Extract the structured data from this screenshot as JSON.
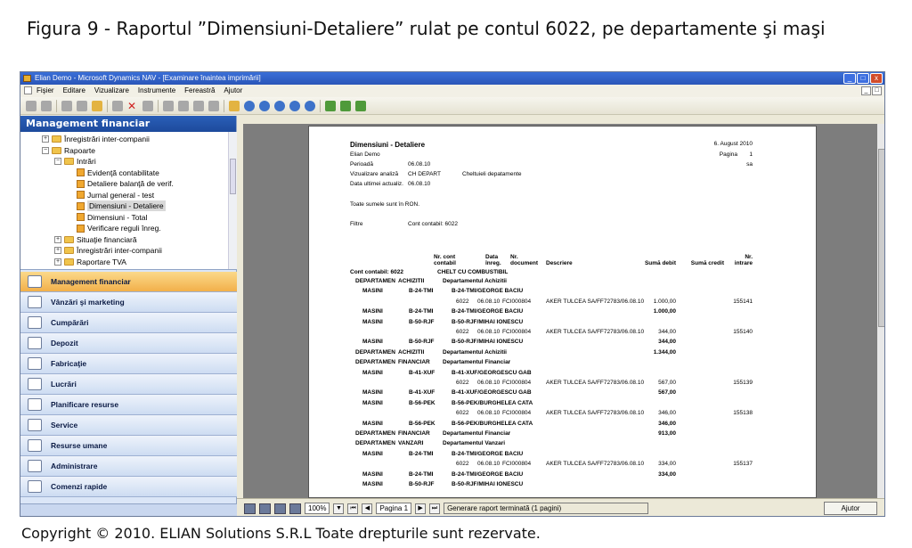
{
  "caption": "Figura 9 - Raportul ”Dimensiuni-Detaliere” rulat pe contul 6022, pe departamente şi maşi",
  "copyright": "Copyright © 2010. ELIAN Solutions S.R.L Toate drepturile sunt rezervate.",
  "window": {
    "title": "Elian Demo - Microsoft Dynamics NAV - [Examinare înaintea imprimării]",
    "buttons": [
      "_",
      "□",
      "x"
    ]
  },
  "menu": [
    "Fişier",
    "Editare",
    "Vizualizare",
    "Instrumente",
    "Fereastră",
    "Ajutor"
  ],
  "nav": {
    "header": "Management financiar",
    "tree": [
      {
        "label": "Înregistrări inter-companii",
        "level": 1,
        "kind": "folder",
        "exp": "+"
      },
      {
        "label": "Rapoarte",
        "level": 1,
        "kind": "folder",
        "exp": "-"
      },
      {
        "label": "Intrări",
        "level": 2,
        "kind": "folder",
        "exp": "-"
      },
      {
        "label": "Evidenţă contabilitate",
        "level": 3,
        "kind": "report"
      },
      {
        "label": "Detaliere balanţă de verif.",
        "level": 3,
        "kind": "report"
      },
      {
        "label": "Jurnal general - test",
        "level": 3,
        "kind": "report"
      },
      {
        "label": "Dimensiuni - Detaliere",
        "level": 3,
        "kind": "report",
        "selected": true
      },
      {
        "label": "Dimensiuni - Total",
        "level": 3,
        "kind": "report"
      },
      {
        "label": "Verificare reguli înreg.",
        "level": 3,
        "kind": "report"
      },
      {
        "label": "Situaţie financiară",
        "level": 2,
        "kind": "folder",
        "exp": "+"
      },
      {
        "label": "Înregistrări inter-companii",
        "level": 2,
        "kind": "folder",
        "exp": "+"
      },
      {
        "label": "Raportare TVA",
        "level": 2,
        "kind": "folder",
        "exp": "+"
      }
    ],
    "modules": [
      {
        "label": "Management financiar",
        "active": true
      },
      {
        "label": "Vânzări şi marketing"
      },
      {
        "label": "Cumpărări"
      },
      {
        "label": "Depozit"
      },
      {
        "label": "Fabricaţie"
      },
      {
        "label": "Lucrări"
      },
      {
        "label": "Planificare resurse"
      },
      {
        "label": "Service"
      },
      {
        "label": "Resurse umane"
      },
      {
        "label": "Administrare"
      },
      {
        "label": "Comenzi rapide"
      }
    ]
  },
  "report": {
    "title": "Dimensiuni - Detaliere",
    "date": "6. August 2010",
    "company": "Elian Demo",
    "page_label": "Pagina",
    "page_no": "1",
    "user": "sa",
    "period_label": "Perioadă",
    "period": "06.08.10",
    "analysis_label": "Vizualizare analiză",
    "analysis_code": "CH DEPART",
    "analysis_name": "Cheltuieli depatamente",
    "last_update_label": "Data ultimei actualiz.",
    "last_update": "06.08.10",
    "currency_note": "Toate sumele sunt în RON.",
    "filter_label": "Filtre",
    "filter_value": "Cont contabil: 6022",
    "col_account": "Nr. cont\ncontabil",
    "col_date": "Data\nînreg.",
    "col_doc": "Nr.\ndocument",
    "col_desc": "Descriere",
    "col_debit": "Sumă debit",
    "col_credit": "Sumă credit",
    "col_entry": "Nr.\nintrare",
    "account_line_label": "Cont contabil: 6022",
    "account_line_name": "CHELT CU COMBUSTIBIL",
    "rows": [
      {
        "c1": "DEPARTAMEN",
        "c2": "ACHIZITII",
        "c3": "Departamentul Achizitii",
        "bold": true,
        "ind": 0
      },
      {
        "c1": "MASINI",
        "c2": "B-24-TMI",
        "c3": "B-24-TMI/GEORGE BACIU",
        "bold": true,
        "ind": 1
      },
      {
        "acct": "6022",
        "date": "06.08.10",
        "doc": "FCI000804",
        "desc": "AKER TULCEA SA/FF72783/06.08.10",
        "debit": "1.000,00",
        "entry": "155141"
      },
      {
        "c1": "MASINI",
        "c2": "B-24-TMI",
        "c3": "B-24-TMI/GEORGE BACIU",
        "bold": true,
        "ind": 1,
        "total": "1.000,00"
      },
      {
        "c1": "MASINI",
        "c2": "B-50-RJF",
        "c3": "B-50-RJF/MIHAI IONESCU",
        "bold": true,
        "ind": 1
      },
      {
        "acct": "6022",
        "date": "06.08.10",
        "doc": "FCI000804",
        "desc": "AKER TULCEA SA/FF72783/06.08.10",
        "debit": "344,00",
        "entry": "155140"
      },
      {
        "c1": "MASINI",
        "c2": "B-50-RJF",
        "c3": "B-50-RJF/MIHAI IONESCU",
        "bold": true,
        "ind": 1,
        "total": "344,00"
      },
      {
        "c1": "DEPARTAMEN",
        "c2": "ACHIZITII",
        "c3": "Departamentul Achizitii",
        "bold": true,
        "ind": 0,
        "total": "1.344,00"
      },
      {
        "c1": "DEPARTAMEN",
        "c2": "FINANCIAR",
        "c3": "Departamentul Financiar",
        "bold": true,
        "ind": 0
      },
      {
        "c1": "MASINI",
        "c2": "B-41-XUF",
        "c3": "B-41-XUF/GEORGESCU GAB",
        "bold": true,
        "ind": 1
      },
      {
        "acct": "6022",
        "date": "06.08.10",
        "doc": "FCI000804",
        "desc": "AKER TULCEA SA/FF72783/06.08.10",
        "debit": "567,00",
        "entry": "155139"
      },
      {
        "c1": "MASINI",
        "c2": "B-41-XUF",
        "c3": "B-41-XUF/GEORGESCU GAB",
        "bold": true,
        "ind": 1,
        "total": "567,00"
      },
      {
        "c1": "MASINI",
        "c2": "B-56-PEK",
        "c3": "B-56-PEK/BURGHELEA CATA",
        "bold": true,
        "ind": 1
      },
      {
        "acct": "6022",
        "date": "06.08.10",
        "doc": "FCI000804",
        "desc": "AKER TULCEA SA/FF72783/06.08.10",
        "debit": "346,00",
        "entry": "155138"
      },
      {
        "c1": "MASINI",
        "c2": "B-56-PEK",
        "c3": "B-56-PEK/BURGHELEA CATA",
        "bold": true,
        "ind": 1,
        "total": "346,00"
      },
      {
        "c1": "DEPARTAMEN",
        "c2": "FINANCIAR",
        "c3": "Departamentul Financiar",
        "bold": true,
        "ind": 0,
        "total": "913,00"
      },
      {
        "c1": "DEPARTAMEN",
        "c2": "VANZARI",
        "c3": "Departamentul Vanzari",
        "bold": true,
        "ind": 0
      },
      {
        "c1": "MASINI",
        "c2": "B-24-TMI",
        "c3": "B-24-TMI/GEORGE BACIU",
        "bold": true,
        "ind": 1
      },
      {
        "acct": "6022",
        "date": "06.08.10",
        "doc": "FCI000804",
        "desc": "AKER TULCEA SA/FF72783/06.08.10",
        "debit": "334,00",
        "entry": "155137"
      },
      {
        "c1": "MASINI",
        "c2": "B-24-TMI",
        "c3": "B-24-TMI/GEORGE BACIU",
        "bold": true,
        "ind": 1,
        "total": "334,00"
      },
      {
        "c1": "MASINI",
        "c2": "B-50-RJF",
        "c3": "B-50-RJF/MIHAI IONESCU",
        "bold": true,
        "ind": 1
      }
    ]
  },
  "status": {
    "zoom": "100%",
    "page": "Pagina 1",
    "message": "Generare raport terminată (1 pagini)",
    "help": "Ajutor"
  }
}
